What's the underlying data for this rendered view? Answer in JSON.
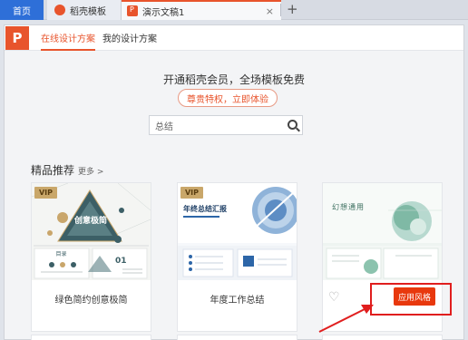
{
  "tabs": {
    "home": "首页",
    "template": "稻壳模板",
    "doc": "演示文稿1",
    "close": "×",
    "new": "+"
  },
  "panel": {
    "logo": "P",
    "tab_online": "在线设计方案",
    "tab_mine": "我的设计方案",
    "promo_title": "开通稻壳会员，全场模板免费",
    "promo_button": "尊贵特权，立即体验",
    "search_value": "总结",
    "section_title": "精品推荐",
    "section_more": "更多 >"
  },
  "cards": [
    {
      "vip": "VIP",
      "caption": "绿色简约创意极简",
      "thumb_title": "创意极简",
      "thumb_sub": "目录",
      "thumb_num": "01"
    },
    {
      "vip": "VIP",
      "caption": "年度工作总结",
      "thumb_title": "年终总结汇报"
    },
    {
      "caption": "",
      "thumb_title": "幻想通用",
      "apply": "应用风格"
    }
  ],
  "colors": {
    "accent": "#e8542c",
    "home_tab": "#2e6fd8",
    "apply_button": "#e8380d",
    "highlight": "#e01e1e"
  }
}
